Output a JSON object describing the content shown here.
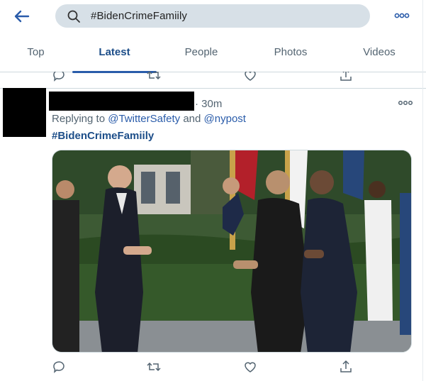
{
  "search": {
    "value": "#BidenCrimeFamiily"
  },
  "tabs": [
    {
      "label": "Top",
      "active": false
    },
    {
      "label": "Latest",
      "active": true
    },
    {
      "label": "People",
      "active": false
    },
    {
      "label": "Photos",
      "active": false
    },
    {
      "label": "Videos",
      "active": false
    }
  ],
  "tweet": {
    "time": "· 30m",
    "replying_prefix": "Replying to ",
    "mention_1": "@TwitterSafety",
    "replying_and": " and ",
    "mention_2": "@nypost",
    "hashtag": "#BidenCrimeFamiily"
  },
  "colors": {
    "accent": "#2a5caa",
    "search_bg": "#d7e0e7",
    "muted": "#536471"
  },
  "icons": [
    "back-arrow-icon",
    "search-icon",
    "more-icon",
    "reply-icon",
    "retweet-icon",
    "like-icon",
    "share-icon"
  ]
}
